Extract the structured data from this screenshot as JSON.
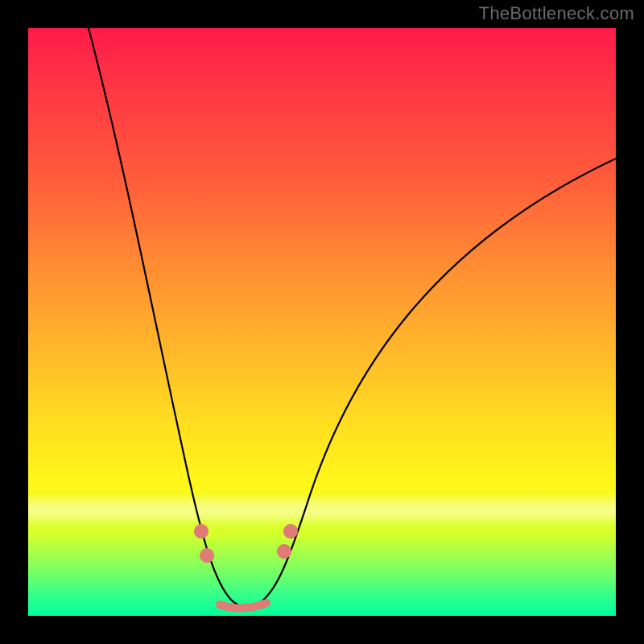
{
  "watermark": "TheBottleneck.com",
  "colors": {
    "gradient_top": "#ff1a4a",
    "gradient_mid": "#ffe01f",
    "gradient_bottom": "#00ff9c",
    "curve": "#000000",
    "markers": "#e07b76",
    "frame": "#000000"
  },
  "chart_data": {
    "type": "line",
    "title": "",
    "xlabel": "",
    "ylabel": "",
    "xlim": [
      0,
      100
    ],
    "ylim": [
      0,
      100
    ],
    "note": "Curve drops from near 100 at left edge to ~0 at x≈35, then rises toward ~78 at right edge. Background color encodes y (0=green, 100=red).",
    "series": [
      {
        "name": "curve",
        "x": [
          10,
          15,
          20,
          25,
          28,
          32,
          35,
          38,
          42,
          48,
          60,
          80,
          100
        ],
        "y": [
          100,
          80,
          55,
          30,
          15,
          5,
          1,
          4,
          14,
          30,
          55,
          72,
          78
        ]
      }
    ],
    "markers": [
      {
        "name": "left-upper",
        "x": 29,
        "y": 14
      },
      {
        "name": "left-lower",
        "x": 30,
        "y": 10
      },
      {
        "name": "right-lower",
        "x": 43,
        "y": 11
      },
      {
        "name": "right-upper",
        "x": 45,
        "y": 14
      }
    ],
    "optimal_range_x": [
      32,
      40
    ]
  }
}
